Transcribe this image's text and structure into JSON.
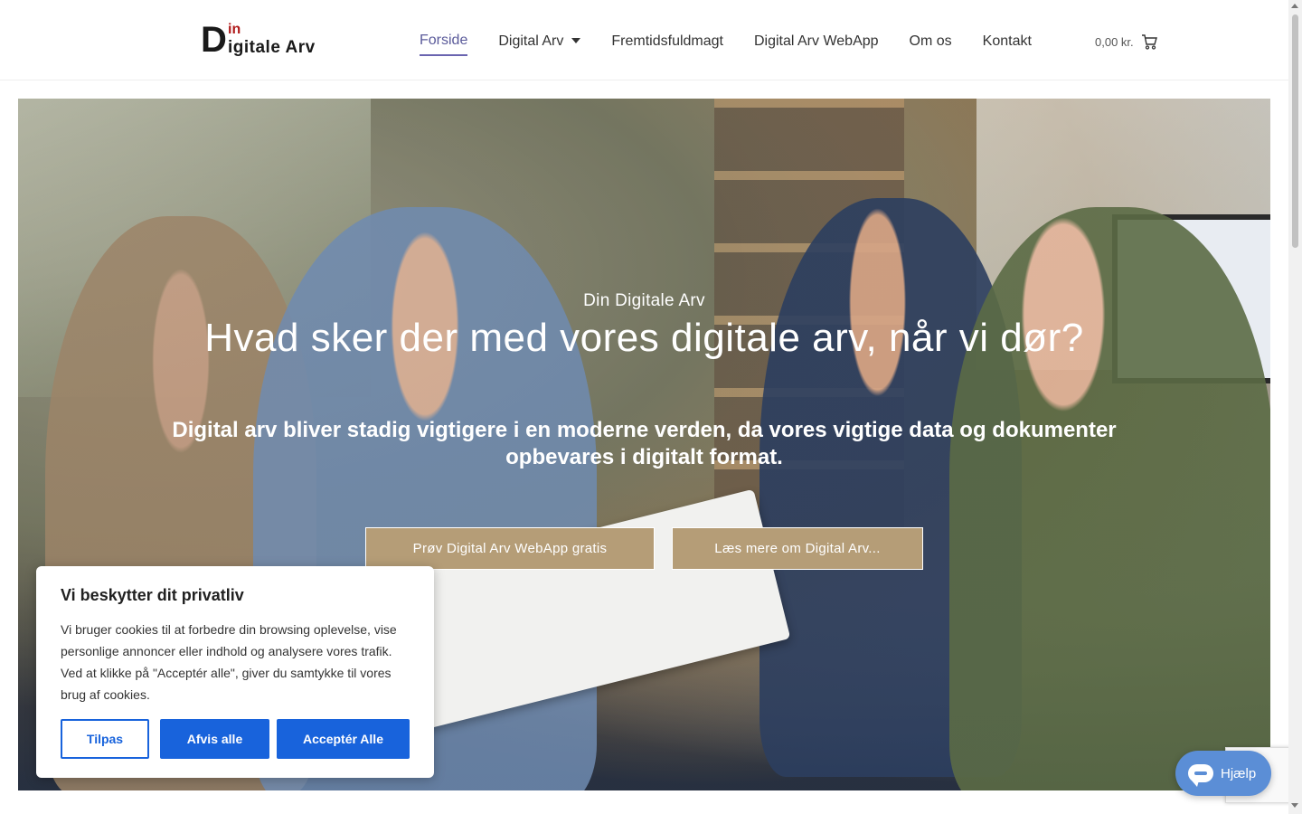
{
  "header": {
    "logo": {
      "d": "D",
      "in": "in",
      "rest": "igitale Arv"
    },
    "nav": [
      {
        "label": "Forside",
        "active": true
      },
      {
        "label": "Digital Arv",
        "has_dropdown": true
      },
      {
        "label": "Fremtidsfuldmagt"
      },
      {
        "label": "Digital Arv WebApp"
      },
      {
        "label": "Om os"
      },
      {
        "label": "Kontakt"
      }
    ],
    "cart": {
      "amount": "0,00 kr.",
      "icon": "cart-icon"
    }
  },
  "hero": {
    "eyebrow": "Din Digitale Arv",
    "title": "Hvad sker der med vores digitale arv, når vi dør?",
    "subtitle": "Digital arv bliver stadig vigtigere i en moderne verden, da vores vigtige data og dokumenter opbevares i digitalt format.",
    "buttons": {
      "try": "Prøv Digital Arv WebApp gratis",
      "read_more": "Læs mere om Digital Arv..."
    },
    "button_color": "#b59d77"
  },
  "cookie": {
    "title": "Vi beskytter dit privatliv",
    "text": "Vi bruger cookies til at forbedre din browsing oplevelse, vise personlige annoncer eller indhold og analysere vores trafik. Ved at klikke på \"Acceptér alle\", giver du samtykke til vores brug af cookies.",
    "customize": "Tilpas",
    "reject": "Afvis alle",
    "accept": "Acceptér Alle",
    "accent": "#1863dc"
  },
  "help": {
    "label": "Hjælp",
    "icon": "chat-icon",
    "color": "#5b8ed6"
  }
}
